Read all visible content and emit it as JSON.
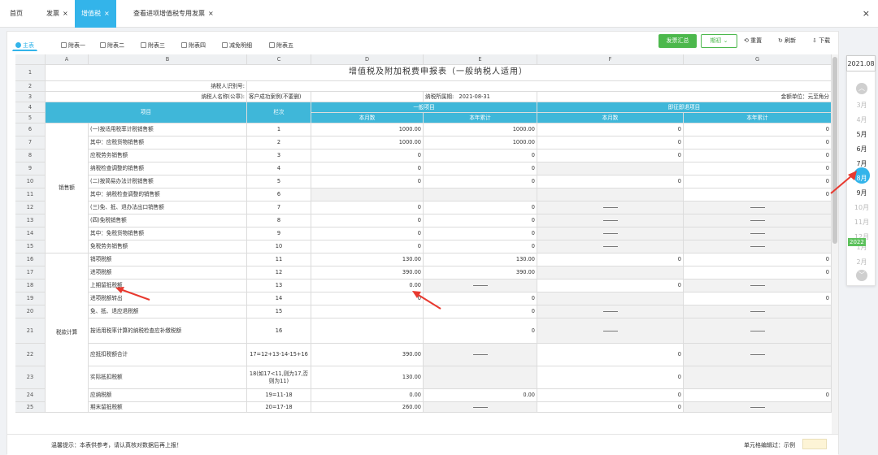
{
  "top_tabs": [
    {
      "label": "首页",
      "closable": false
    },
    {
      "label": "发票",
      "closable": true
    },
    {
      "label": "增值税",
      "closable": true,
      "active": true
    },
    {
      "label": "查看进项增值税专用发票",
      "closable": true
    }
  ],
  "close_all_label": "×",
  "sheet_tabs": [
    "主表",
    "附表一",
    "附表二",
    "附表三",
    "附表四",
    "减免明细",
    "附表五"
  ],
  "toolbar": {
    "summary_label": "发票汇总",
    "init_label": "期初",
    "reset_label": "重置",
    "refresh_label": "刷新",
    "download_label": "下载"
  },
  "columns": [
    "A",
    "B",
    "C",
    "D",
    "E",
    "F",
    "G"
  ],
  "sheet": {
    "title": "增值税及附加税费申报表（一般纳税人适用）",
    "taxpayer_id_label": "纳税人识别号:",
    "taxpayer_name_label": "纳税人名称(公章):",
    "taxpayer_name_value": "客户成功案例(不要删)",
    "period_label": "纳税所属期:",
    "period_value": "2021-08-31",
    "unit_label": "金额单位：元至角分",
    "header_item": "项目",
    "header_col": "栏次",
    "header_general": "一般项目",
    "header_refund": "即征即退项目",
    "header_month": "本月数",
    "header_year": "本年累计",
    "group_sales": "销售额",
    "group_tax": "税款计算"
  },
  "rows": [
    {
      "n": "6",
      "item": "(一)按适用税率计税销售额",
      "col": "1",
      "d": "1000.00",
      "e": "1000.00",
      "f": "0",
      "g": "0"
    },
    {
      "n": "7",
      "item": "其中：应税货物销售额",
      "col": "2",
      "d": "1000.00",
      "e": "1000.00",
      "f": "0",
      "g": "0"
    },
    {
      "n": "8",
      "item": "应税劳务销售额",
      "col": "3",
      "d": "0",
      "e": "0",
      "f": "0",
      "g": "0"
    },
    {
      "n": "9",
      "item": "纳税检查调整的销售额",
      "col": "4",
      "d": "0",
      "e": "0",
      "f": "",
      "g": "0"
    },
    {
      "n": "10",
      "item": "(二)按简易办法计税销售额",
      "col": "5",
      "d": "0",
      "e": "0",
      "f": "0",
      "g": "0"
    },
    {
      "n": "11",
      "item": "其中：纳税检查调整的销售额",
      "col": "6",
      "d": "",
      "e": "",
      "f": "",
      "g": "0"
    },
    {
      "n": "12",
      "item": "(三)免、抵、退办法出口销售额",
      "col": "7",
      "d": "0",
      "e": "0",
      "f": "—",
      "g": "—"
    },
    {
      "n": "13",
      "item": "(四)免税销售额",
      "col": "8",
      "d": "0",
      "e": "0",
      "f": "—",
      "g": "—"
    },
    {
      "n": "14",
      "item": "其中：免税货物销售额",
      "col": "9",
      "d": "0",
      "e": "0",
      "f": "—",
      "g": "—"
    },
    {
      "n": "15",
      "item": "免税劳务销售额",
      "col": "10",
      "d": "0",
      "e": "0",
      "f": "—",
      "g": "—"
    },
    {
      "n": "16",
      "item": "销项税额",
      "col": "11",
      "d": "130.00",
      "e": "130.00",
      "f": "0",
      "g": "0"
    },
    {
      "n": "17",
      "item": "进项税额",
      "col": "12",
      "d": "390.00",
      "e": "390.00",
      "f": "",
      "g": "0"
    },
    {
      "n": "18",
      "item": "上期留抵税额",
      "col": "13",
      "d": "0.00",
      "e": "—",
      "f": "0",
      "g": "—"
    },
    {
      "n": "19",
      "item": "进项税额转出",
      "col": "14",
      "d": "0",
      "e": "0",
      "f": "",
      "g": "0"
    },
    {
      "n": "20",
      "item": "免、抵、退应退税额",
      "col": "15",
      "d": "",
      "e": "0",
      "f": "—",
      "g": "—"
    },
    {
      "n": "21",
      "item": "按适用税率计算的纳税检查应补缴税额",
      "col": "16",
      "d": "",
      "e": "0",
      "f": "—",
      "g": "—"
    },
    {
      "n": "22",
      "item": "应抵扣税额合计",
      "col": "17=12+13-14-15+16",
      "d": "390.00",
      "e": "—",
      "f": "0",
      "g": "—"
    },
    {
      "n": "23",
      "item": "实际抵扣税额",
      "col": "18(如17<11,则为17,否则为11)",
      "d": "130.00",
      "e": "",
      "f": "0",
      "g": ""
    },
    {
      "n": "24",
      "item": "应纳税额",
      "col": "19=11-18",
      "d": "0.00",
      "e": "0.00",
      "f": "0",
      "g": "0"
    },
    {
      "n": "25",
      "item": "期末留抵税额",
      "col": "20=17-18",
      "d": "260.00",
      "e": "—",
      "f": "0",
      "g": "—"
    }
  ],
  "footer": {
    "tip": "温馨提示：本表供参考，请认真核对数据后再上报！",
    "legend_label": "单元格编辑过：示例"
  },
  "timeline": {
    "year_top": "2021.08",
    "months_2021": [
      "3月",
      "4月",
      "5月",
      "6月",
      "7月",
      "8月",
      "9月",
      "10月",
      "11月",
      "12月"
    ],
    "year_next": "2022",
    "months_2022": [
      "1月",
      "2月"
    ],
    "selected": "8月"
  },
  "colors": {
    "accent": "#33b4ea",
    "header_teal": "#3fb7d9",
    "green": "#4cb84c",
    "arrow": "#e8392f"
  }
}
